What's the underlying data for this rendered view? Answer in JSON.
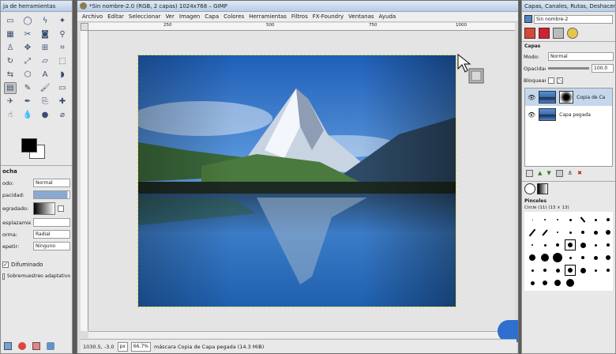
{
  "toolbox": {
    "title": "ja de herramientas",
    "options_title": "ocha",
    "options": [
      {
        "label": "odo:",
        "value": "Normal"
      },
      {
        "label": "pacidad:",
        "value": ""
      },
      {
        "label": "egradado:",
        "value": ""
      },
      {
        "label": "esplazamiento:",
        "value": ""
      },
      {
        "label": "orma:",
        "value": "Radial"
      },
      {
        "label": "epetir:",
        "value": "Ninguno"
      }
    ],
    "dithering_label": "Difuminado",
    "adaptive_label": "Sobremuestreo adaptativo"
  },
  "main": {
    "title": "*Sin nombre-2.0 (RGB, 2 capas) 1024x768 – GIMP",
    "menu": [
      "Archivo",
      "Editar",
      "Seleccionar",
      "Ver",
      "Imagen",
      "Capa",
      "Colores",
      "Herramientas",
      "Filtros",
      "FX-Foundry",
      "Ventanas",
      "Ayuda"
    ],
    "ruler_marks": [
      "250",
      "500",
      "750",
      "1000"
    ],
    "status": {
      "coords": "1030.5, -3.0",
      "unit": "px",
      "zoom": "66.7%",
      "message": "máscara Copia de Capa pegada (14.3 MiB)"
    }
  },
  "dock": {
    "title": "Capas, Canales, Rutas, Deshacer – ...",
    "image_select": "Sin nombre-2",
    "layers_tab": "Capas",
    "mode_label": "Modo:",
    "mode_value": "Normal",
    "opacity_label": "Opacidad:",
    "opacity_value": "100.0",
    "lock_label": "Bloquear:",
    "layers": [
      {
        "name": "Copia de Ca",
        "selected": true
      },
      {
        "name": "Capa pegada",
        "selected": false
      }
    ],
    "brushes_title": "Pinceles",
    "brushes_subtitle": "Circle (11) (13 × 13)"
  },
  "colors": {
    "accent": "#c5d7ec",
    "sky": "#3f7fd0",
    "blue_fab": "#2f6fd0"
  }
}
